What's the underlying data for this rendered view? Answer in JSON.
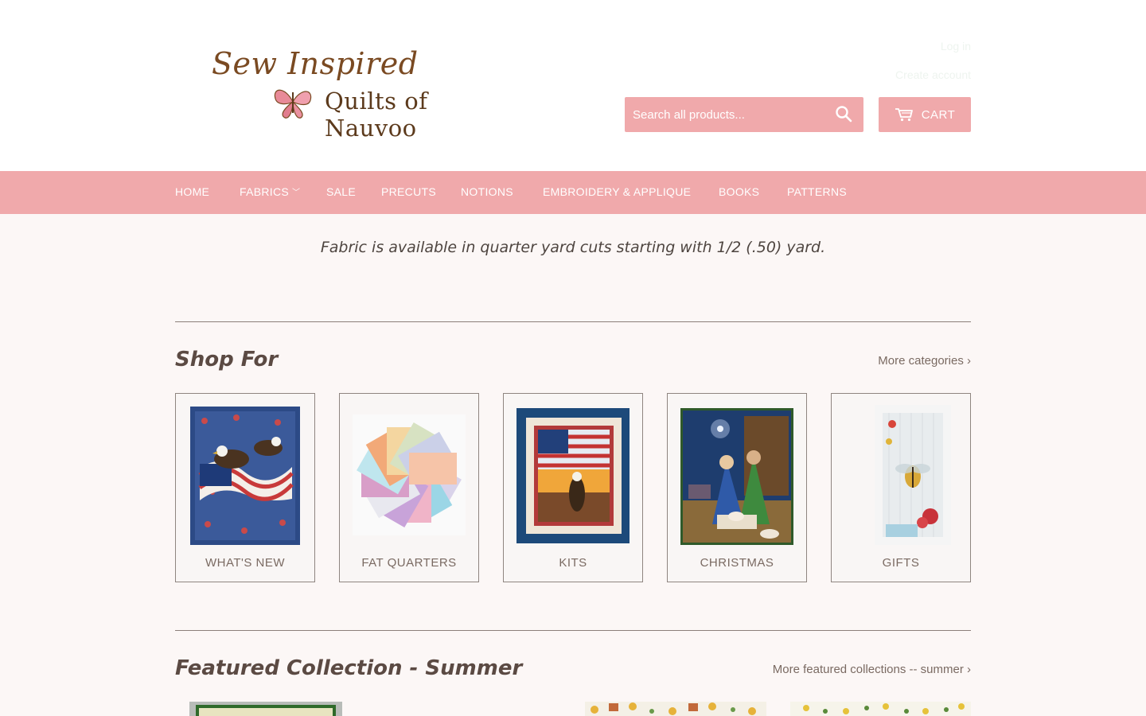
{
  "brand": {
    "script_text": "Sew Inspired",
    "serif_text": "Quilts of Nauvoo",
    "accent_color": "#f0a9ab"
  },
  "header": {
    "faint_link_1": "Log in",
    "faint_link_2": "Create account",
    "search_placeholder": "Search all products...",
    "search_icon": "search-icon",
    "cart_label": "CART",
    "cart_icon": "cart-icon"
  },
  "nav": {
    "items": [
      {
        "label": "HOME"
      },
      {
        "label": "FABRICS",
        "has_dropdown": true
      },
      {
        "label": "SALE"
      },
      {
        "label": "PRECUTS"
      },
      {
        "label": "NOTIONS"
      },
      {
        "label": "EMBROIDERY & APPLIQUE"
      },
      {
        "label": "BOOKS"
      },
      {
        "label": "PATTERNS"
      }
    ]
  },
  "notice": "Fabric is available in quarter yard cuts starting with 1/2 (.50) yard.",
  "shop_for": {
    "title": "Shop For",
    "more_link": "More categories ›",
    "cards": [
      {
        "label": "WHAT'S NEW"
      },
      {
        "label": "FAT QUARTERS"
      },
      {
        "label": "KITS"
      },
      {
        "label": "CHRISTMAS"
      },
      {
        "label": "GIFTS"
      }
    ]
  },
  "featured": {
    "title": "Featured Collection - Summer",
    "more_link": "More featured collections -- summer ›"
  }
}
